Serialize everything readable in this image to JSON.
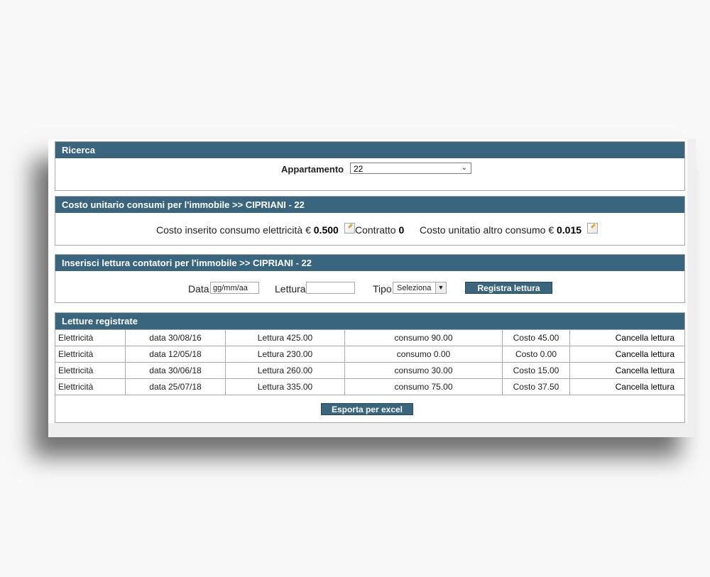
{
  "search": {
    "title": "Ricerca",
    "label": "Appartamento",
    "selected": "22"
  },
  "unit_cost": {
    "title": "Costo unitario consumi per l'immobile >> CIPRIANI - 22",
    "electric_label": "Costo inserito consumo elettricità €",
    "electric_value": "0.500",
    "contract_label": "Contratto",
    "contract_value": "0",
    "other_label": "Costo unitatio altro consumo €",
    "other_value": "0.015"
  },
  "insert": {
    "title": "Inserisci lettura contatori per l'immobile >> CIPRIANI - 22",
    "date_label": "Data",
    "date_value": "gg/mm/aa",
    "reading_label": "Lettura",
    "reading_value": "",
    "type_label": "Tipo",
    "type_value": "Seleziona",
    "submit_label": "Registra lettura"
  },
  "readings": {
    "title": "Letture registrate",
    "rows": [
      {
        "type": "Elettricità",
        "date": "data 30/08/16",
        "reading": "Lettura 425.00",
        "consumption": "consumo 90.00",
        "cost": "Costo 45.00",
        "action": "Cancella lettura"
      },
      {
        "type": "Elettricità",
        "date": "data 12/05/18",
        "reading": "Lettura 230.00",
        "consumption": "consumo 0.00",
        "cost": "Costo 0.00",
        "action": "Cancella lettura"
      },
      {
        "type": "Elettricità",
        "date": "data 30/06/18",
        "reading": "Lettura 260.00",
        "consumption": "consumo 30.00",
        "cost": "Costo 15.00",
        "action": "Cancella lettura"
      },
      {
        "type": "Elettricità",
        "date": "data 25/07/18",
        "reading": "Lettura 335.00",
        "consumption": "consumo 75.00",
        "cost": "Costo 37.50",
        "action": "Cancella lettura"
      }
    ],
    "export_label": "Esporta per excel"
  },
  "colors": {
    "header_bg": "#3a657e",
    "border": "#a8a8a8"
  }
}
